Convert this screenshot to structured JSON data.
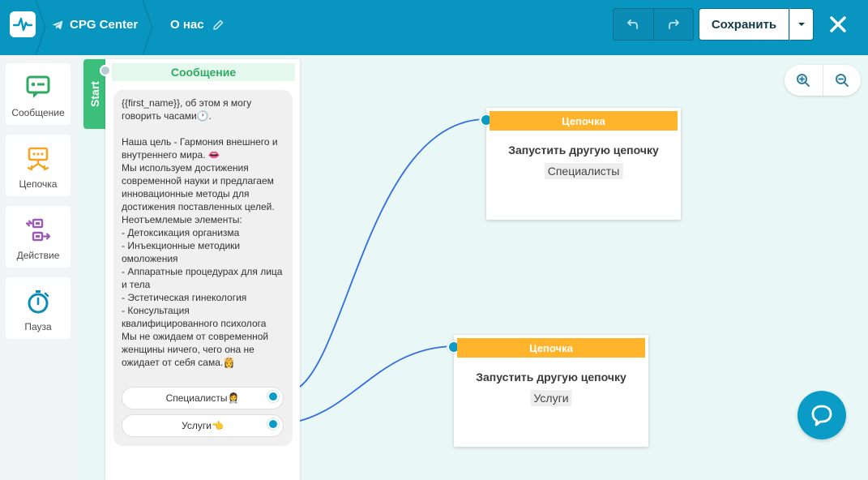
{
  "header": {
    "bot_name": "CPG Center",
    "page_name": "О нас",
    "save_label": "Сохранить"
  },
  "toolbox": {
    "items": [
      {
        "label": "Сообщение",
        "icon": "message-icon"
      },
      {
        "label": "Цепочка",
        "icon": "chain-icon"
      },
      {
        "label": "Действие",
        "icon": "action-icon"
      },
      {
        "label": "Пауза",
        "icon": "timer-icon"
      }
    ]
  },
  "start_label": "Start",
  "message_node": {
    "title": "Сообщение",
    "text": "{{first_name}},  об этом я могу говорить часами🕐.\n\nНаша цель - Гармония внешнего и внутреннего мира. 👄\nМы используем достижения современной науки и предлагаем инновационные методы для достижения поставленных целей.\nНеотъемлемые элементы:\n- Детоксикация организма\n- Инъекционные методики омоложения\n- Аппаратные процедурах для лица и тела\n- Эстетическая гинекология\n- Консультация квалифицированного психолога\nМы не ожидаем от современной женщины ничего, чего она не ожидает от себя сама.👸",
    "buttons": [
      {
        "label": "Специалисты👩‍⚕️"
      },
      {
        "label": "Услуги👈"
      }
    ]
  },
  "chain_nodes": [
    {
      "header": "Цепочка",
      "title": "Запустить другую цепочку",
      "target": "Специалисты"
    },
    {
      "header": "Цепочка",
      "title": "Запустить другую цепочку",
      "target": "Услуги"
    }
  ],
  "colors": {
    "header_bg": "#0895c0",
    "start_green": "#3cbf7a",
    "chain_orange": "#ffb42c",
    "port_blue": "#0a9cc7",
    "wire_blue": "#2f6de0",
    "canvas_bg": "#eaf7f7"
  }
}
